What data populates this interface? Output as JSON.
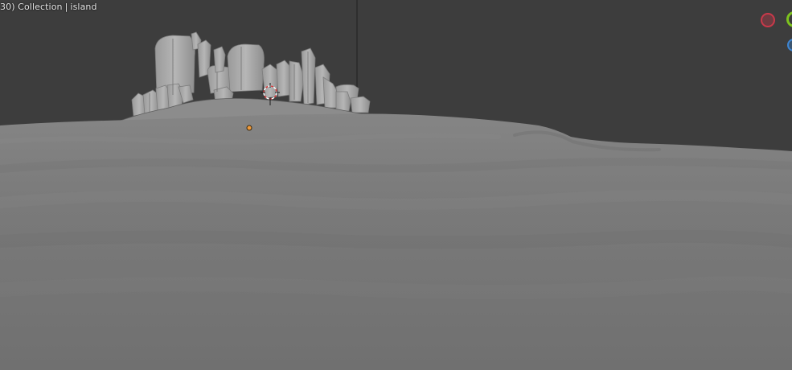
{
  "viewport": {
    "overlay": {
      "frame_prefix": "30) Collection",
      "separator": "|",
      "object_name": "island"
    },
    "colors": {
      "background": "#3d3d3d",
      "ground": "#777777",
      "island": "#8a8a8a",
      "rocks": "#a8a8a8",
      "origin_dot": "#f09a3a",
      "gizmo_x": "#c9394a",
      "gizmo_y": "#7dc31e",
      "gizmo_z": "#3d86d4"
    },
    "gizmo": {
      "x_icon": "axis-x-icon",
      "y_icon": "axis-y-icon",
      "z_icon": "axis-z-icon"
    }
  }
}
